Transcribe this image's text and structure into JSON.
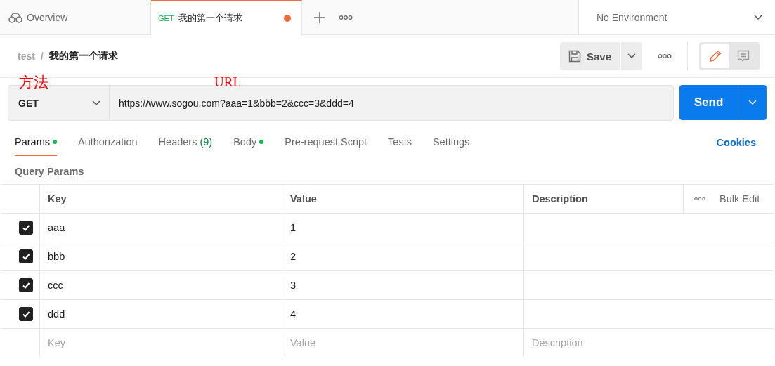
{
  "tabs": [
    {
      "kind": "overview",
      "label": "Overview",
      "selected": false
    },
    {
      "kind": "request",
      "method": "GET",
      "label": "我的第一个请求",
      "selected": true,
      "unsaved": true
    }
  ],
  "environment": {
    "value": "No Environment"
  },
  "breadcrumb": {
    "collection": "test",
    "separator": "/",
    "request": "我的第一个请求"
  },
  "save_button": {
    "label": "Save"
  },
  "modes": [
    {
      "kind": "edit",
      "selected": true
    },
    {
      "kind": "comments",
      "selected": false
    }
  ],
  "annotations": [
    {
      "text": "方法"
    },
    {
      "text": "URL"
    }
  ],
  "request": {
    "method": "GET",
    "url": "https://www.sogou.com?aaa=1&bbb=2&ccc=3&ddd=4",
    "send": "Send"
  },
  "request_tabs": [
    {
      "label": "Params",
      "selected": true,
      "dot": true
    },
    {
      "label": "Authorization",
      "selected": false,
      "dot": false
    },
    {
      "label": "Headers",
      "count": "(9)",
      "selected": false,
      "dot": false
    },
    {
      "label": "Body",
      "selected": false,
      "dot": true
    },
    {
      "label": "Pre-request Script",
      "selected": false,
      "dot": false
    },
    {
      "label": "Tests",
      "selected": false,
      "dot": false
    },
    {
      "label": "Settings",
      "selected": false,
      "dot": false
    }
  ],
  "cookies_link": "Cookies",
  "section_title": "Query Params",
  "table": {
    "columns": [
      "Key",
      "Value",
      "Description"
    ],
    "bulk_edit": "Bulk Edit",
    "rows": [
      {
        "key": "aaa",
        "value": "1",
        "checked": true
      },
      {
        "key": "bbb",
        "value": "2",
        "checked": true
      },
      {
        "key": "ccc",
        "value": "3",
        "checked": true
      },
      {
        "key": "ddd",
        "value": "4",
        "checked": true
      }
    ],
    "placeholders": {
      "key": "Key",
      "value": "Value",
      "description": "Description"
    }
  }
}
